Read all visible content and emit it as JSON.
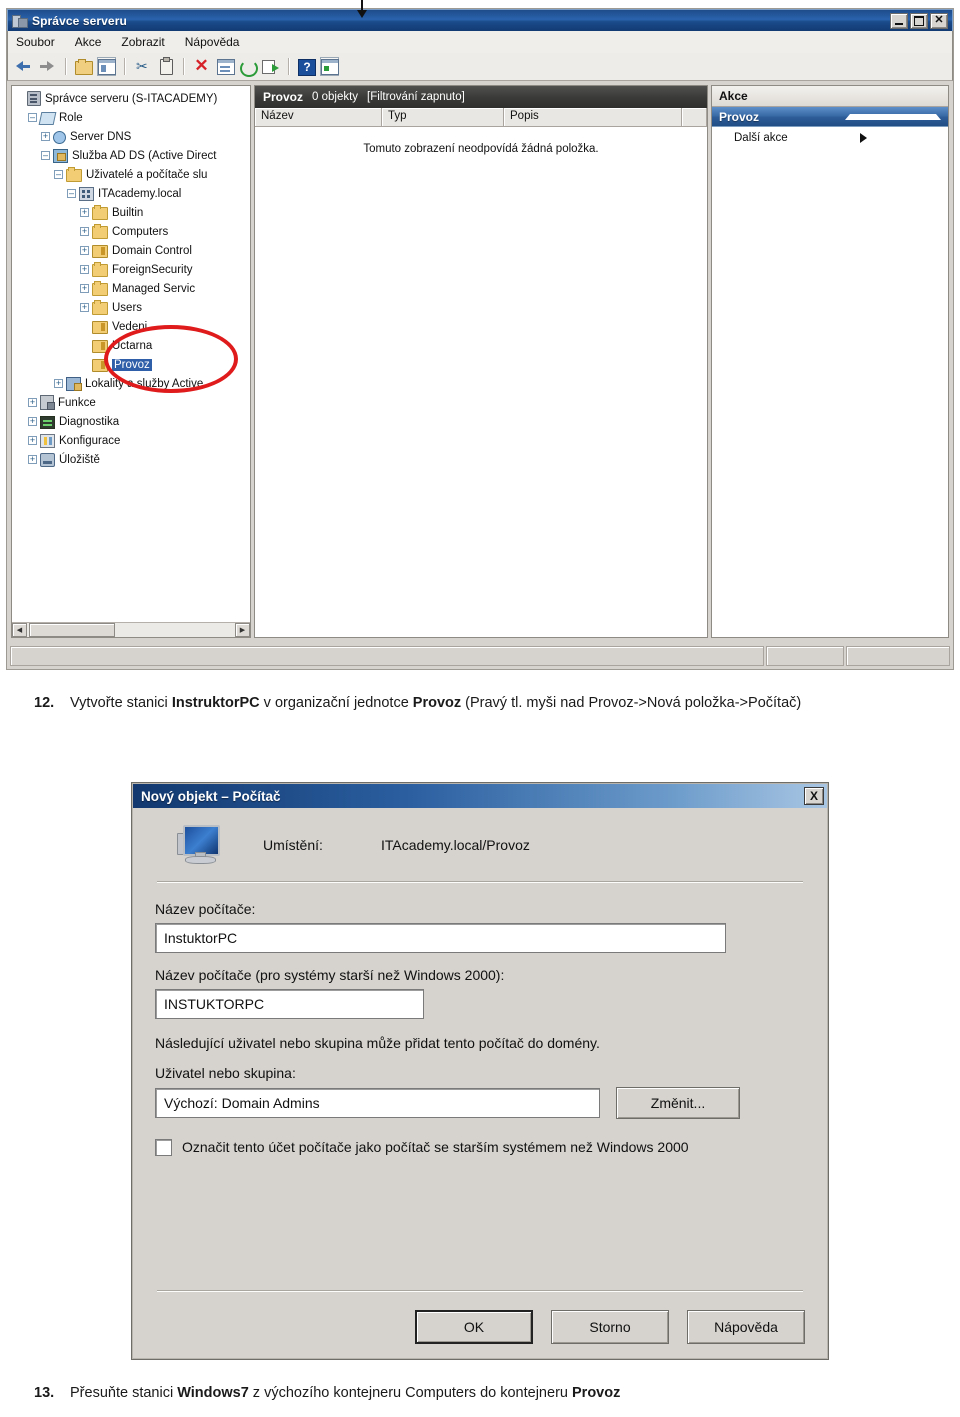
{
  "server_manager": {
    "title": "Správce serveru",
    "window_buttons": {
      "minimize": "_",
      "maximize": "□",
      "close": "×"
    },
    "menu": [
      {
        "label": "Soubor"
      },
      {
        "label": "Akce"
      },
      {
        "label": "Zobrazit"
      },
      {
        "label": "Nápověda"
      }
    ],
    "toolbar_icons": [
      "back-arrow-icon",
      "forward-arrow-icon",
      "up-folder-icon",
      "show-hide-tree-icon",
      "cut-icon",
      "paste-icon",
      "delete-icon",
      "properties-icon",
      "refresh-icon",
      "export-list-icon",
      "help-icon",
      "show-action-pane-icon"
    ],
    "tree": [
      {
        "label": "Správce serveru (S-ITACADEMY)",
        "indent": 0,
        "expander": "none",
        "icon": "server-manager-icon",
        "selected": false
      },
      {
        "label": "Role",
        "indent": 1,
        "expander": "minus",
        "icon": "roles-icon",
        "selected": false
      },
      {
        "label": "Server DNS",
        "indent": 2,
        "expander": "plus",
        "icon": "dns-icon",
        "selected": false
      },
      {
        "label": "Služba AD DS (Active Direct",
        "indent": 2,
        "expander": "minus",
        "icon": "adds-icon",
        "selected": false
      },
      {
        "label": "Uživatelé a počítače slu",
        "indent": 3,
        "expander": "minus",
        "icon": "folder-icon",
        "selected": false
      },
      {
        "label": "ITAcademy.local",
        "indent": 4,
        "expander": "minus",
        "icon": "domain-icon",
        "selected": false
      },
      {
        "label": "Builtin",
        "indent": 5,
        "expander": "plus",
        "icon": "folder-icon",
        "selected": false
      },
      {
        "label": "Computers",
        "indent": 5,
        "expander": "plus",
        "icon": "folder-icon",
        "selected": false
      },
      {
        "label": "Domain Control",
        "indent": 5,
        "expander": "plus",
        "icon": "ou-icon",
        "selected": false
      },
      {
        "label": "ForeignSecurity",
        "indent": 5,
        "expander": "plus",
        "icon": "folder-icon",
        "selected": false
      },
      {
        "label": "Managed Servic",
        "indent": 5,
        "expander": "plus",
        "icon": "folder-icon",
        "selected": false
      },
      {
        "label": "Users",
        "indent": 5,
        "expander": "plus",
        "icon": "folder-icon",
        "selected": false
      },
      {
        "label": "Vedeni",
        "indent": 5,
        "expander": "none",
        "icon": "ou-icon",
        "selected": false
      },
      {
        "label": "Uctarna",
        "indent": 5,
        "expander": "none",
        "icon": "ou-icon",
        "selected": false
      },
      {
        "label": "Provoz",
        "indent": 5,
        "expander": "none",
        "icon": "ou-icon",
        "selected": true
      },
      {
        "label": "Lokality a služby Active",
        "indent": 3,
        "expander": "plus",
        "icon": "sites-icon",
        "selected": false
      },
      {
        "label": "Funkce",
        "indent": 1,
        "expander": "plus",
        "icon": "features-icon",
        "selected": false
      },
      {
        "label": "Diagnostika",
        "indent": 1,
        "expander": "plus",
        "icon": "diagnostics-icon",
        "selected": false
      },
      {
        "label": "Konfigurace",
        "indent": 1,
        "expander": "plus",
        "icon": "configuration-icon",
        "selected": false
      },
      {
        "label": "Úložiště",
        "indent": 1,
        "expander": "plus",
        "icon": "storage-icon",
        "selected": false
      }
    ],
    "center": {
      "header_name": "Provoz",
      "header_count": "0 objekty",
      "header_filter": "[Filtrování zapnuto]",
      "columns": [
        "Název",
        "Typ",
        "Popis",
        ""
      ],
      "empty_message": "Tomuto zobrazení neodpovídá žádná položka."
    },
    "actions_pane": {
      "title": "Akce",
      "group_title": "Provoz",
      "items": [
        {
          "label": "Další akce"
        }
      ]
    },
    "annotation_color": "#e01b1b"
  },
  "step12": {
    "number": "12.",
    "part1": "Vytvořte stanici ",
    "bold1": "InstruktorPC",
    "part2": " v organizační jednotce ",
    "bold2": "Provoz",
    "part3": " (Pravý tl. myši nad Provoz->Nová položka->Počítač)"
  },
  "dialog": {
    "title": "Nový objekt – Počítač",
    "close_label": "X",
    "location_label": "Umístění:",
    "location_value": "ITAcademy.local/Provoz",
    "computer_name_label": "Název počítače:",
    "computer_name_value": "InstuktorPC",
    "computer_name_pre2000_label": "Název počítače (pro systémy starší než Windows 2000):",
    "computer_name_pre2000_value": "INSTUKTORPC",
    "description": "Následující uživatel nebo skupina může přidat tento počítač do domény.",
    "user_group_label": "Uživatel nebo skupina:",
    "user_group_value": "Výchozí: Domain Admins",
    "change_button": "Změnit...",
    "checkbox_label": "Označit tento účet počítače jako počítač se starším systémem než Windows 2000",
    "checkbox_checked": false,
    "ok_button": "OK",
    "cancel_button": "Storno",
    "help_button": "Nápověda"
  },
  "step13": {
    "number": "13.",
    "part1": "Přesuňte stanici ",
    "bold1": "Windows7",
    "part2": " z výchozího kontejneru Computers do kontejneru ",
    "bold2": "Provoz"
  }
}
